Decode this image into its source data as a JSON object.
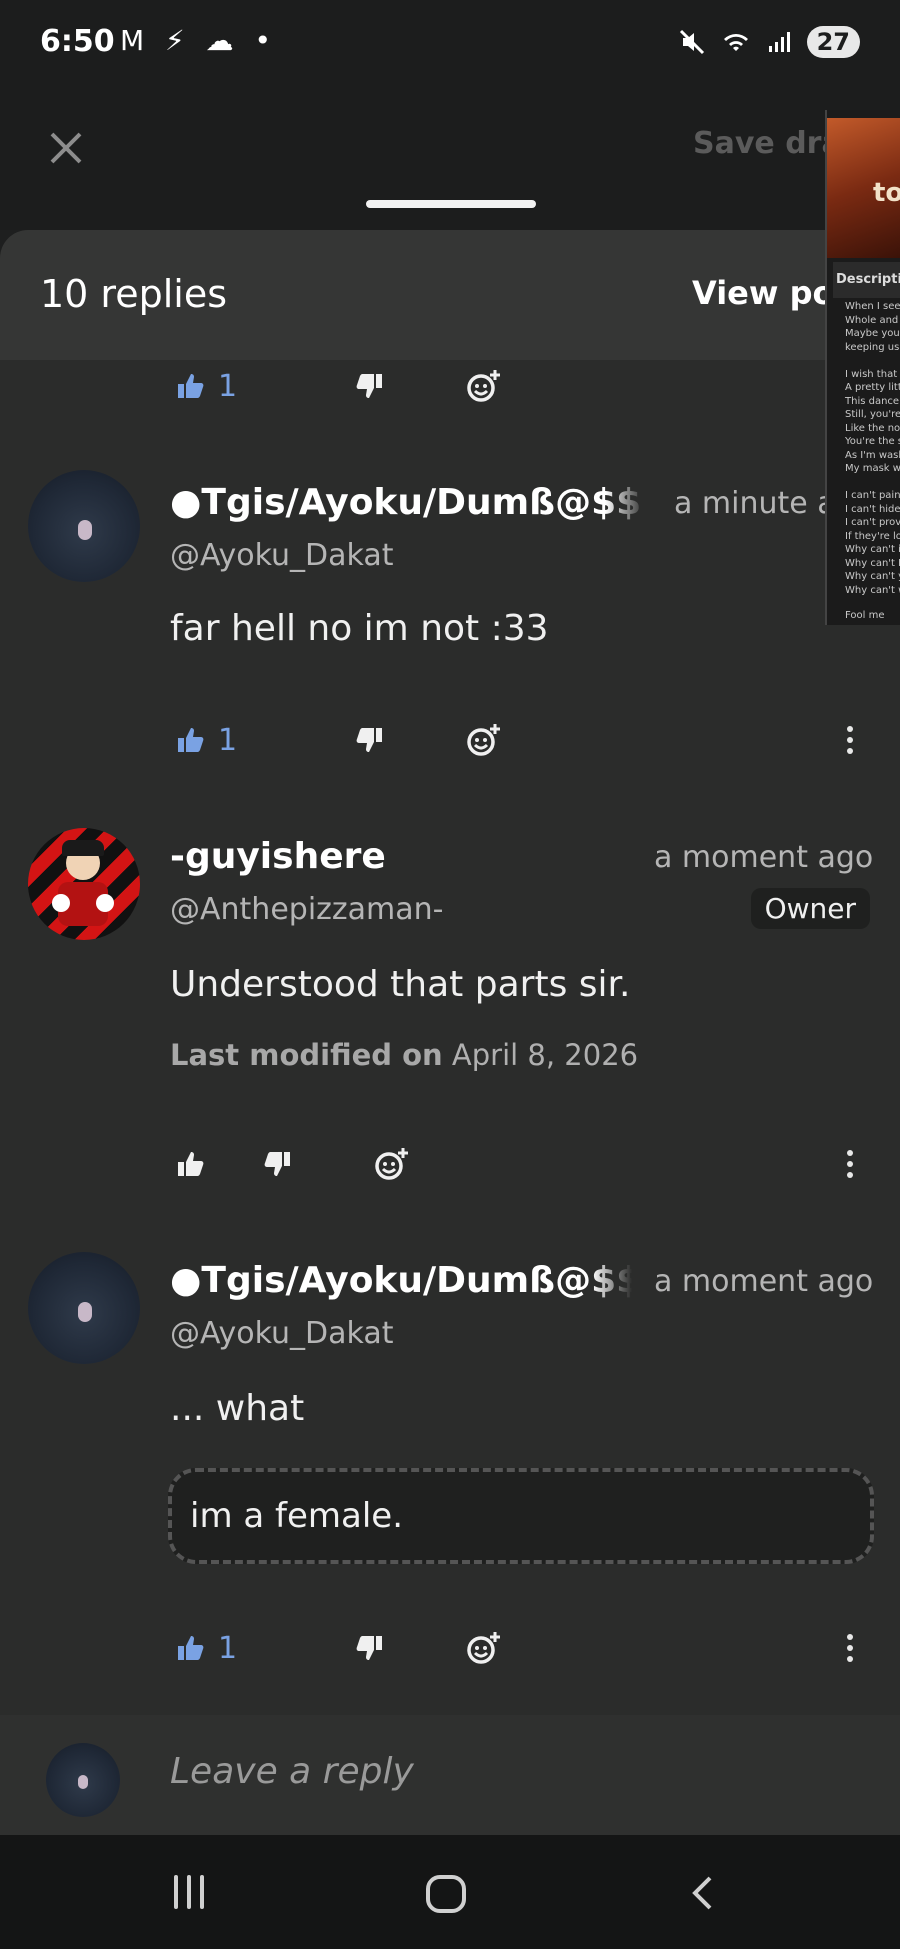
{
  "status": {
    "time": "6:50",
    "left_icons": "M ⚡ ☁ •",
    "battery": "27"
  },
  "topbar": {
    "save_draft": "Save dra"
  },
  "sheet": {
    "replies_count": "10 replies",
    "view_post": "View pos"
  },
  "reactions": {
    "top_partial_count": "1"
  },
  "comments": [
    {
      "username": "●Tgis/Ayoku/Dumß@$$!",
      "handle": "@Ayoku_Dakat",
      "time": "a minute a",
      "body": "far hell no im not :33",
      "likes": "1"
    },
    {
      "username": "-guyishere",
      "handle": "@Anthepizzaman-",
      "time": "a moment ago",
      "badge": "Owner",
      "body": "Understood that parts sir.",
      "modified_label": "Last modified on",
      "modified_date": "April 8, 2026"
    },
    {
      "username": "●Tgis/Ayoku/Dumß@$$",
      "handle": "@Ayoku_Dakat",
      "time": "a moment ago",
      "body": "... what",
      "quote": "im a female.",
      "likes": "1"
    }
  ],
  "reply": {
    "placeholder": "Leave a reply"
  },
  "thumbnail": {
    "title": "to",
    "description_header": "Descriptio",
    "lines": "When I see\nWhole and\nMaybe you'\nkeeping us\n\nI wish that\nA pretty littl\nThis dance\nStill, you're\nLike the no\nYou're the s\nAs I'm wash\nMy mask w\n\nI can't paint\nI can't hide\nI can't prov\nIf they're lo\nWhy can't it\nWhy can't I\nWhy can't y\nWhy can't w",
    "footer": "Fool me"
  }
}
